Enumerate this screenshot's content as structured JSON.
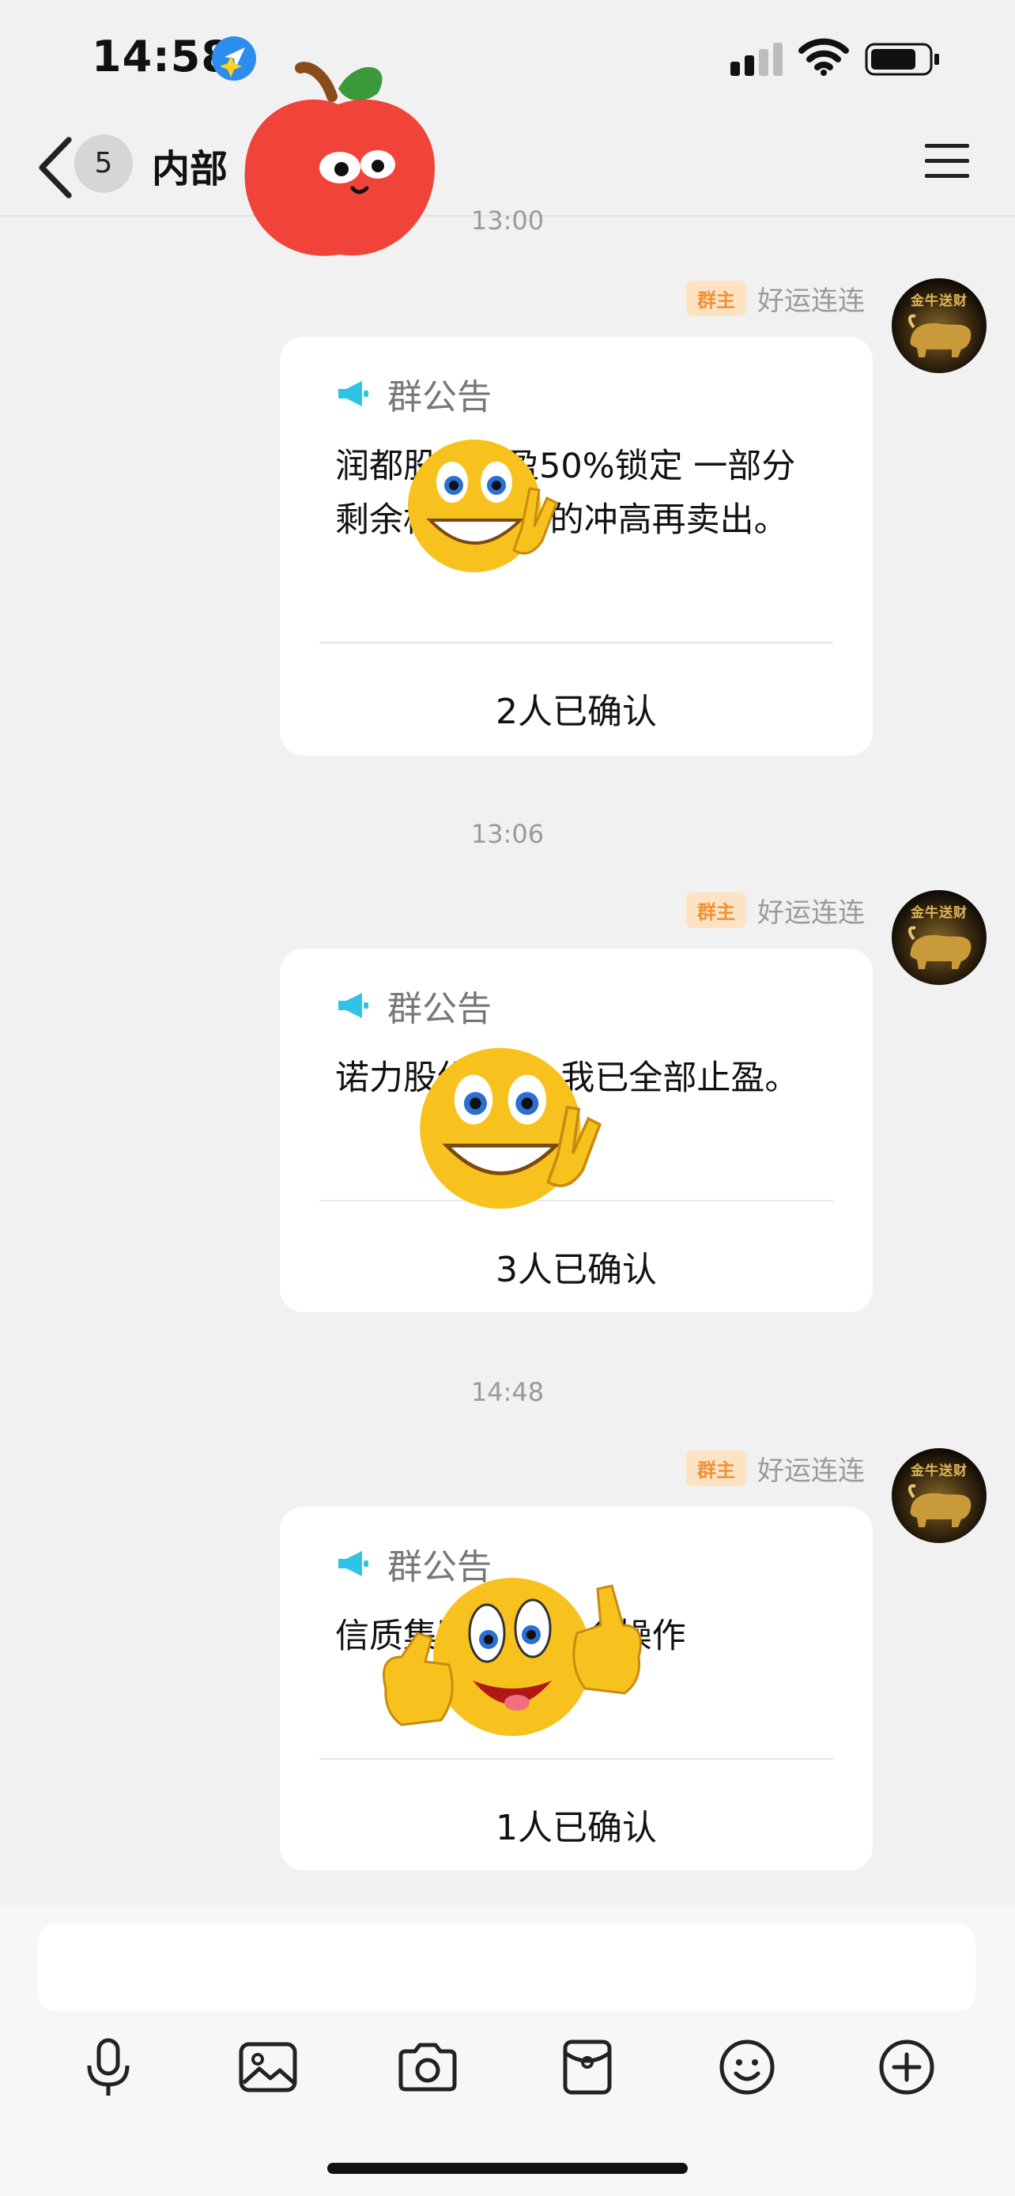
{
  "status_bar": {
    "time": "14:58"
  },
  "nav": {
    "back_count": "5",
    "title": "内部"
  },
  "messages": [
    {
      "timestamp": "13:00",
      "sender_badge": "群主",
      "sender_name": "好运连连",
      "card_title": "群公告",
      "body": "润都股份止盈50%锁定 一部分 剩余格局一下 的冲高再卖出。",
      "confirm": "2人已确认"
    },
    {
      "timestamp": "13:06",
      "sender_badge": "群主",
      "sender_name": "好运连连",
      "card_title": "群公告",
      "body": "诺力股份 股份 我已全部止盈。",
      "confirm": "3人已确认"
    },
    {
      "timestamp": "14:48",
      "sender_badge": "群主",
      "sender_name": "好运连连",
      "card_title": "群公告",
      "body": "信质集团 我五成仓操作",
      "confirm": "1人已确认"
    }
  ],
  "avatar_text": "金牛送财",
  "input": {
    "placeholder": ""
  },
  "toolbar": [
    "mic-icon",
    "image-icon",
    "camera-icon",
    "red-packet-icon",
    "emoji-icon",
    "plus-icon"
  ],
  "colors": {
    "accent_megaphone": "#2ec4e6",
    "owner_badge_bg": "#fde2c4",
    "owner_badge_text": "#f19136"
  }
}
